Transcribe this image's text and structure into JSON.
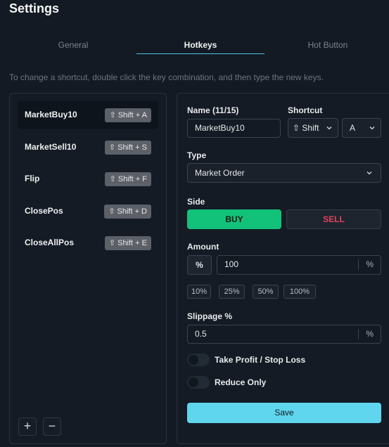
{
  "header": {
    "title": "Settings"
  },
  "tabs": [
    {
      "label": "General"
    },
    {
      "label": "Hotkeys",
      "active": true
    },
    {
      "label": "Hot Button"
    }
  ],
  "hint": "To change a shortcut, double click the key combination, and then type the new keys.",
  "hotkeys": [
    {
      "name": "MarketBuy10",
      "key": "⇧ Shift + A",
      "selected": true
    },
    {
      "name": "MarketSell10",
      "key": "⇧ Shift + S"
    },
    {
      "name": "Flip",
      "key": "⇧ Shift + F"
    },
    {
      "name": "ClosePos",
      "key": "⇧ Shift + D"
    },
    {
      "name": "CloseAllPos",
      "key": "⇧ Shift + E"
    }
  ],
  "list_actions": {
    "add": "+",
    "remove": "−"
  },
  "form": {
    "name_label": "Name (11/15)",
    "name_value": "MarketBuy10",
    "shortcut_label": "Shortcut",
    "shortcut_modifier": "⇧ Shift",
    "shortcut_key": "A",
    "type_label": "Type",
    "type_value": "Market Order",
    "side_label": "Side",
    "buy_label": "BUY",
    "sell_label": "SELL",
    "amount_label": "Amount",
    "amount_mode": "%",
    "amount_value": "100",
    "amount_unit": "%",
    "amount_presets": [
      "10%",
      "25%",
      "50%",
      "100%"
    ],
    "slippage_label": "Slippage %",
    "slippage_value": "0.5",
    "slippage_unit": "%",
    "tpsl_label": "Take Profit / Stop Loss",
    "tpsl_enabled": false,
    "reduce_label": "Reduce Only",
    "reduce_enabled": false,
    "save_label": "Save"
  },
  "colors": {
    "background": "#131a23",
    "accent": "#4cc3e6",
    "buy": "#12c27a",
    "sell": "#e0425a",
    "save": "#5fd5ee"
  }
}
